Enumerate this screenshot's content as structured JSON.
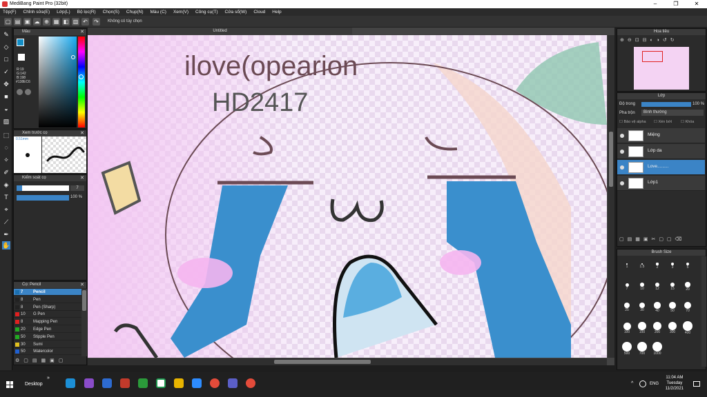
{
  "window": {
    "title": "MediBang Paint Pro (32bit)",
    "min": "–",
    "max": "❐",
    "close": "✕"
  },
  "menu": [
    "Tệp(F)",
    "Chỉnh sửa(E)",
    "Lớp(L)",
    "Bộ lọc(R)",
    "Chọn(S)",
    "Chụp(N)",
    "Màu (C)",
    "Xem(V)",
    "Công cụ(T)",
    "Cửa sổ(W)",
    "Cloud",
    "Help"
  ],
  "toolbar": {
    "selection_hint": "Không có tùy chọn"
  },
  "panels": {
    "color": {
      "title": "Màu",
      "r": "R:19",
      "g": "G:142",
      "b": "B:198",
      "hex": "#138EC6"
    },
    "brush_preview": {
      "title": "Xem trước cọ",
      "size": "0.51mm"
    },
    "brush_control": {
      "title": "Kiểm soát cọ",
      "size_value": "7",
      "opacity_value": "100 %"
    },
    "brush_list": {
      "title": "Cọ: Pencil",
      "items": [
        {
          "size": "7",
          "name": "Pencil",
          "color": "#1a6fb0",
          "selected": true
        },
        {
          "size": "8",
          "name": "Pen",
          "color": "#222222"
        },
        {
          "size": "8",
          "name": "Pen (Sharp)",
          "color": "#222222"
        },
        {
          "size": "10",
          "name": "G Pen",
          "color": "#e02020"
        },
        {
          "size": "8",
          "name": "Mapping Pen",
          "color": "#e02020"
        },
        {
          "size": "20",
          "name": "Edge Pen",
          "color": "#22aa22"
        },
        {
          "size": "50",
          "name": "Stipple Pen",
          "color": "#22aa22"
        },
        {
          "size": "30",
          "name": "Sumi",
          "color": "#e0c020"
        },
        {
          "size": "50",
          "name": "Watercolor",
          "color": "#2060d0"
        }
      ]
    },
    "navigator": {
      "title": "Hoa tiêu"
    },
    "layer": {
      "title": "Lớp",
      "opacity_label": "Độ trong",
      "opacity_value": "100 %",
      "blend_label": "Pha trộn",
      "blend_value": "Bình thường",
      "protect_alpha": "Bảo vệ alpha",
      "clipping": "Xén bớt",
      "lock": "Khóa",
      "layers": [
        {
          "name": "Miệng",
          "selected": false
        },
        {
          "name": "Lớp da",
          "selected": false
        },
        {
          "name": "Love.........",
          "selected": true
        },
        {
          "name": "Lớp1",
          "selected": false
        }
      ]
    },
    "brush_size": {
      "title": "Brush Size",
      "sizes": [
        "1",
        "1.5",
        "2",
        "3",
        "5",
        "7",
        "10",
        "12",
        "15",
        "20",
        "25",
        "30",
        "40",
        "50",
        "70",
        "100",
        "150",
        "200",
        "300",
        "400",
        "500",
        "700",
        "1000"
      ]
    }
  },
  "canvas": {
    "tab_title": "Untitled",
    "text1": "ilove(opearion",
    "text2": "HD2417"
  },
  "taskbar": {
    "desktop": "Desktop",
    "chevron": "»",
    "lang": "ENG",
    "time": "11:04 AM",
    "day": "Tuesday",
    "date": "11/2/2021",
    "up": "^"
  }
}
